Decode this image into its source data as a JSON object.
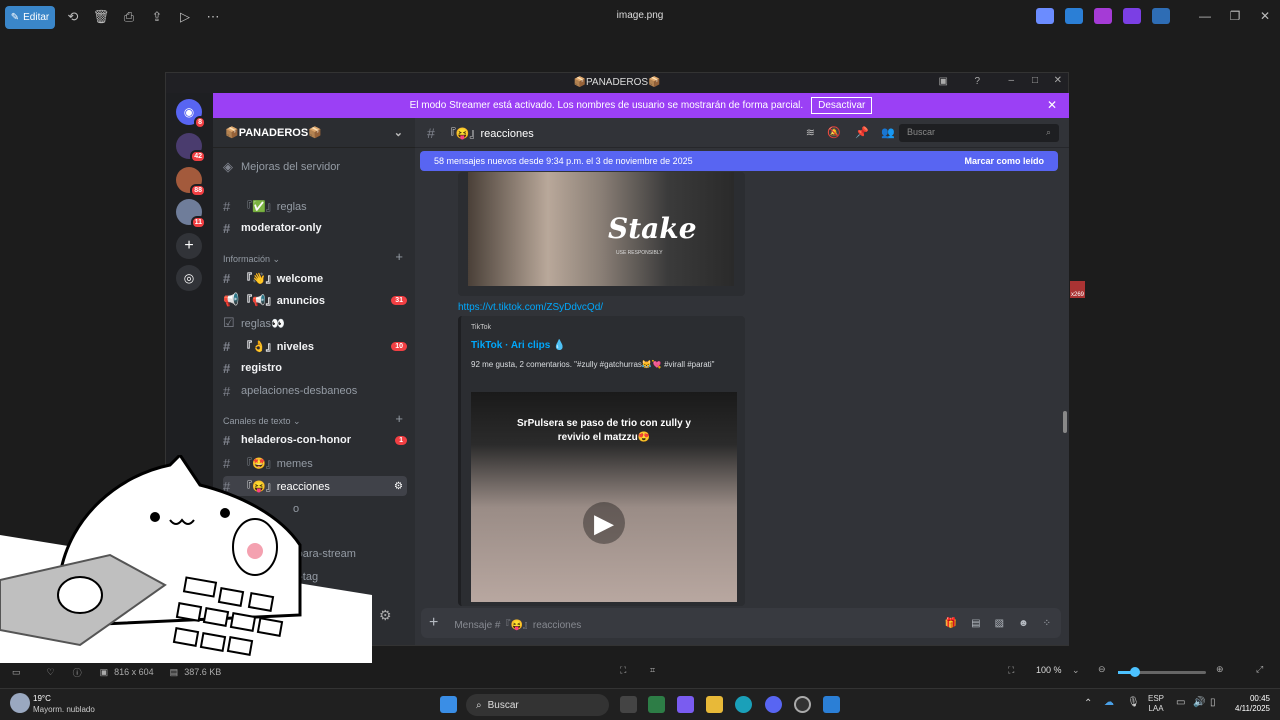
{
  "viewer": {
    "edit_label": "Editar",
    "file_name": "image.png",
    "dimensions": "816 x 604",
    "file_size": "387.6 KB",
    "zoom": "100 %"
  },
  "discord": {
    "window_title": "📦PANADEROS📦",
    "streamer_text": "El modo Streamer está activado. Los nombres de usuario se mostrarán de forma parcial.",
    "streamer_button": "Desactivar",
    "server_name": "📦PANADEROS📦",
    "guild_badges": [
      "8",
      "42",
      "88",
      "11"
    ],
    "channels": {
      "boost": "Mejoras del servidor",
      "rules_top": "『✅』reglas",
      "moderator": "moderator-only",
      "cat_info": "Información",
      "welcome": "『👋』welcome",
      "anuncios": "『📢』anuncios",
      "anuncios_badge": "31",
      "reglas": "reglas👀",
      "niveles": "『👌』niveles",
      "niveles_badge": "10",
      "registro": "registro",
      "apelaciones": "apelaciones-desbaneos",
      "cat_text": "Canales de texto",
      "heladeros": "heladeros-con-honor",
      "heladeros_badge": "1",
      "memes": "『🤩』memes",
      "reacciones": "『😝』reacciones",
      "partial1": "o",
      "partial2": "-para-stream",
      "partial3": "e-tag"
    },
    "chat": {
      "channel_name": "『😝』reacciones",
      "search_placeholder": "Buscar",
      "new_messages": "58 mensajes nuevos desde 9:34 p.m. el 3 de noviembre de 2025",
      "mark_read": "Marcar como leído",
      "link": "https://vt.tiktok.com/ZSyDdvcQd/",
      "embed_provider": "TikTok",
      "embed_title": "TikTok · Ari clips 💧",
      "embed_desc": "92 me gusta, 2 comentarios. \"#zully #gatchurras😹💘 #virall #parati\"",
      "video_caption": "SrPulsera se paso de trio con zully y revivio el matzzu😍",
      "stake_text": "Stake",
      "stake_sub": "USE RESPONSIBLY",
      "composer_placeholder": "Mensaje #『😝』reacciones"
    }
  },
  "taskbar": {
    "weather_temp": "19°C",
    "weather_desc": "Mayorm. nublado",
    "search": "Buscar",
    "lang1": "ESP",
    "lang2": "LAA",
    "time": "00:45",
    "date": "4/11/2025",
    "edge_badge": "x269"
  }
}
